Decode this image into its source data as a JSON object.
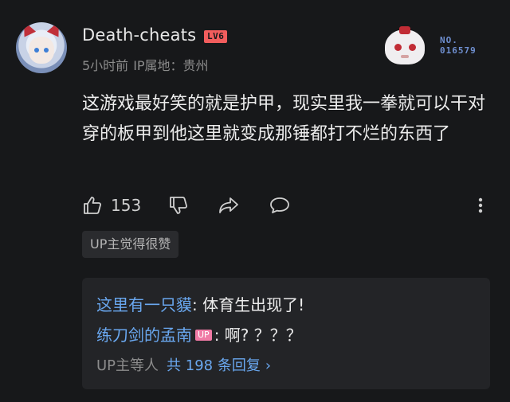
{
  "user": {
    "name": "Death-cheats",
    "level": "LV6",
    "time": "5小时前",
    "ip_location": "IP属地：贵州"
  },
  "badge": {
    "label": "NO.",
    "number": "016579"
  },
  "comment": {
    "text": "这游戏最好笑的就是护甲，现实里我一拳就可以干对穿的板甲到他这里就变成那锤都打不烂的东西了"
  },
  "actions": {
    "like_count": "153",
    "icons": [
      "thumbs-up-icon",
      "thumbs-down-icon",
      "share-icon",
      "reply-icon",
      "more-icon"
    ]
  },
  "up_liked_tag": "UP主觉得很赞",
  "replies": [
    {
      "name": "这里有一只貘",
      "tag": "",
      "text": ": 体育生出现了!"
    },
    {
      "name": "练刀剑的孟南",
      "tag": "UP",
      "text": ": 啊? ？？？"
    }
  ],
  "reply_summary": {
    "prefix": "UP主等人",
    "total": "共 198 条回复",
    "chevron": "›"
  },
  "colors": {
    "background": "#17181a",
    "link_blue": "#6aa8f0",
    "level_red": "#f25d5d",
    "up_pink": "#f07aa5"
  }
}
